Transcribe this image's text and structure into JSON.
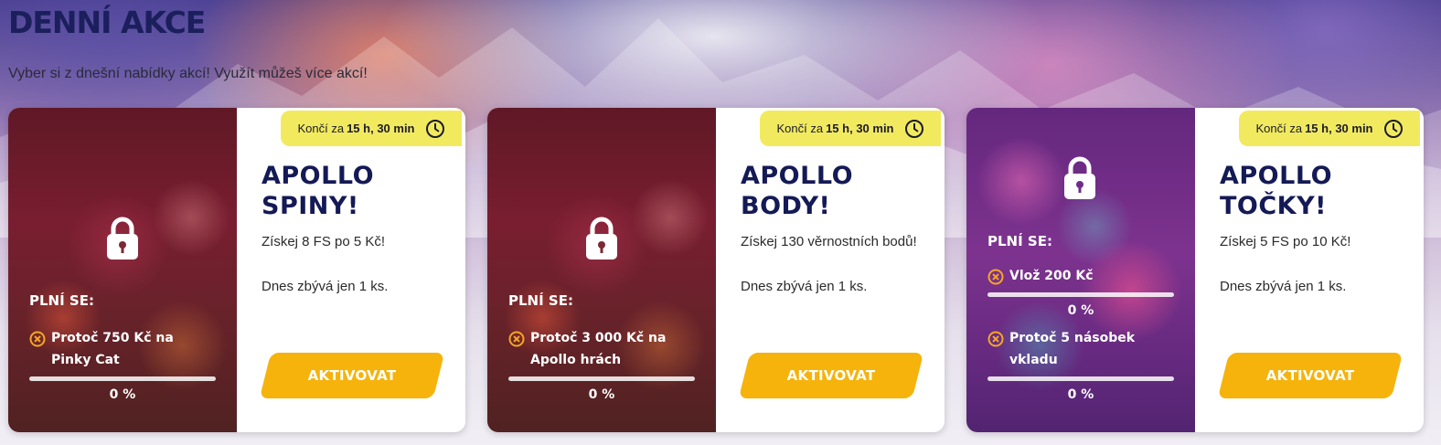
{
  "header": {
    "title": "DENNÍ AKCE",
    "subtitle": "Vyber si z dnešní nabídky akcí! Využít můžeš více akcí!"
  },
  "colors": {
    "title": "#1b1f5c",
    "badge": "#f2ea5e",
    "button": "#f5b30c",
    "cond_icon": "#f5a623"
  },
  "cards": [
    {
      "badge": {
        "prefix": "Končí za",
        "time": "15 h, 30 min",
        "icon": "clock-icon"
      },
      "lock_icon": "lock-icon",
      "conditions_label": "PLNÍ SE:",
      "conditions": [
        {
          "icon": "x-circle-icon",
          "text": "Protoč 750 Kč na Pinky Cat",
          "progress": 0,
          "progress_label": "0 %"
        }
      ],
      "title": "APOLLO SPINY!",
      "description": "Získej 8 FS po 5 Kč!",
      "stock": "Dnes zbývá jen 1 ks.",
      "button": "AKTIVOVAT"
    },
    {
      "badge": {
        "prefix": "Končí za",
        "time": "15 h, 30 min",
        "icon": "clock-icon"
      },
      "lock_icon": "lock-icon",
      "conditions_label": "PLNÍ SE:",
      "conditions": [
        {
          "icon": "x-circle-icon",
          "text": "Protoč 3 000 Kč na Apollo hrách",
          "progress": 0,
          "progress_label": "0 %"
        }
      ],
      "title": "APOLLO BODY!",
      "description": "Získej 130 věrnostních bodů!",
      "stock": "Dnes zbývá jen 1 ks.",
      "button": "AKTIVOVAT"
    },
    {
      "badge": {
        "prefix": "Končí za",
        "time": "15 h, 30 min",
        "icon": "clock-icon"
      },
      "lock_icon": "lock-icon",
      "conditions_label": "PLNÍ SE:",
      "conditions": [
        {
          "icon": "x-circle-icon",
          "text": "Vlož 200 Kč",
          "progress": 0,
          "progress_label": "0 %"
        },
        {
          "icon": "x-circle-icon",
          "text": "Protoč 5 násobek vkladu",
          "progress": 0,
          "progress_label": "0 %"
        }
      ],
      "title": "APOLLO TOČKY!",
      "description": "Získej 5 FS po 10 Kč!",
      "stock": "Dnes zbývá jen 1 ks.",
      "button": "AKTIVOVAT"
    }
  ]
}
